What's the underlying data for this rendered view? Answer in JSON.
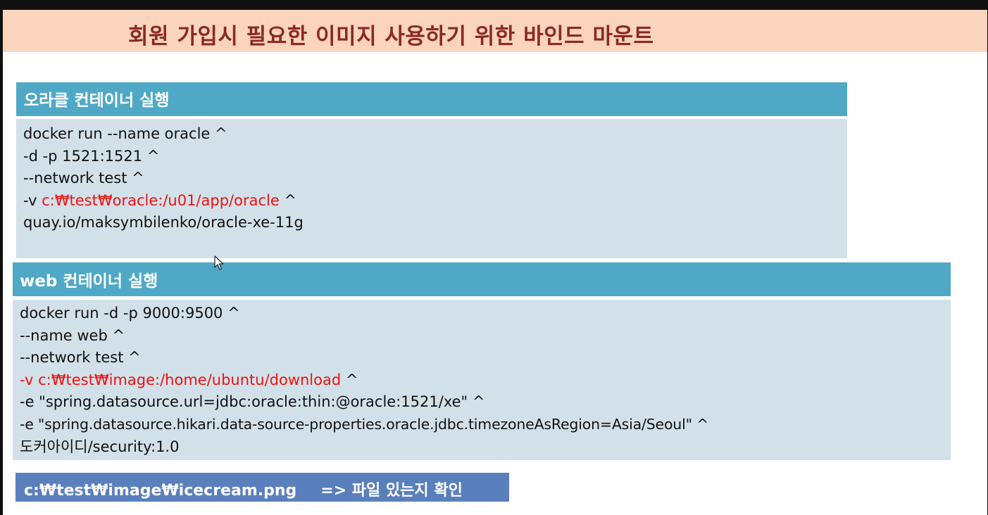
{
  "slide": {
    "title": "회원 가입시 필요한 이미지 사용하기 위한 바인드 마운트"
  },
  "oracle_block": {
    "header": "오라클 컨테이너 실행",
    "lines": {
      "l1": "docker run --name oracle ^",
      "l2": "-d -p 1521:1521  ^",
      "l3": "--network test  ^",
      "l4_prefix": "-v ",
      "l4_red": "c:₩test₩oracle:/u01/app/oracle",
      "l4_suffix": "  ^",
      "l5": "quay.io/maksymbilenko/oracle-xe-11g"
    }
  },
  "web_block": {
    "header": "web 컨테이너 실행",
    "lines": {
      "l1": "docker run -d -p 9000:9500  ^",
      "l2": "--name web  ^",
      "l3": "--network test  ^",
      "l4_red": "-v c:₩test₩image:/home/ubuntu/download",
      "l4_suffix": "  ^",
      "l5": "-e \"spring.datasource.url=jdbc:oracle:thin:@oracle:1521/xe\"  ^",
      "l6": "-e \"spring.datasource.hikari.data-source-properties.oracle.jdbc.timezoneAsRegion=Asia/Seoul\"  ^",
      "l7": "도커아이디/security:1.0"
    }
  },
  "footer": {
    "path": "c:₩test₩image₩icecream.png",
    "note": "=> 파일 있는지 확인"
  },
  "colors": {
    "title_bg": "#fbd4bd",
    "title_text": "#8b2a21",
    "header_bg": "#4fa9c6",
    "body_bg": "#d2e1e9",
    "highlight_red": "#ee1111",
    "footer_bg": "#5a7fbd"
  },
  "icons": {
    "cursor": "mouse-pointer-icon"
  }
}
